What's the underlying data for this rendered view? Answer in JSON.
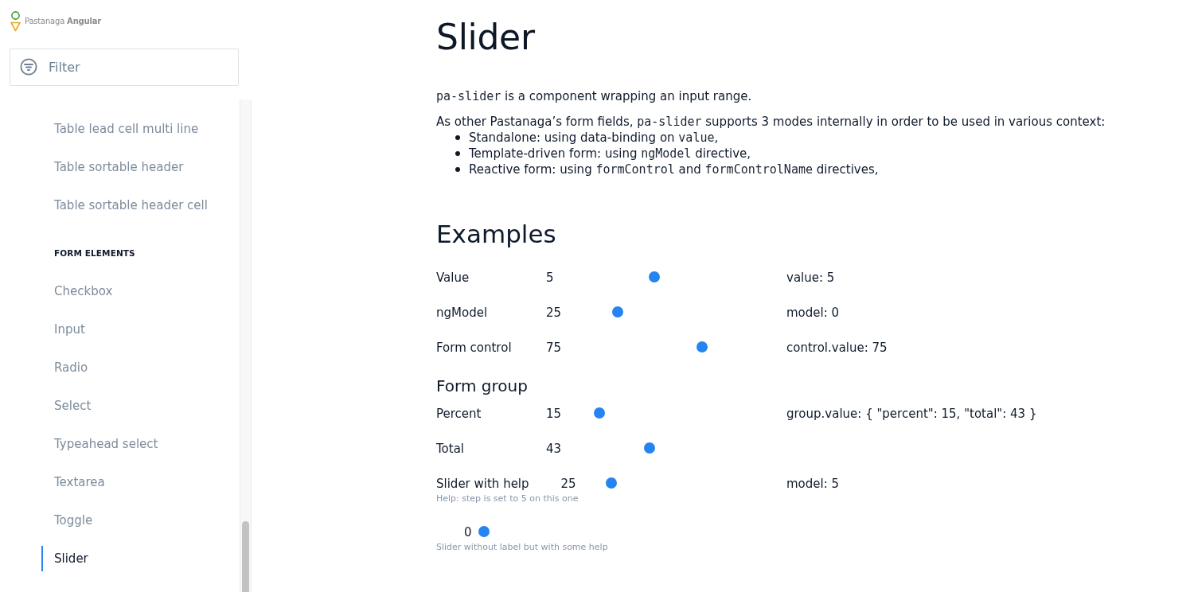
{
  "sidebar": {
    "logo": {
      "text": "Pastanaga **Angular**"
    },
    "filter": {
      "placeholder": "Filter"
    },
    "sections": [
      {
        "items": [
          {
            "label": "Table lead cell multi line",
            "selected": false
          },
          {
            "label": "Table sortable header",
            "selected": false
          },
          {
            "label": "Table sortable header cell",
            "selected": false
          }
        ]
      },
      {
        "heading": "FORM ELEMENTS",
        "items": [
          {
            "label": "Checkbox",
            "selected": false
          },
          {
            "label": "Input",
            "selected": false
          },
          {
            "label": "Radio",
            "selected": false
          },
          {
            "label": "Select",
            "selected": false
          },
          {
            "label": "Typeahead select",
            "selected": false
          },
          {
            "label": "Textarea",
            "selected": false
          },
          {
            "label": "Toggle",
            "selected": false
          },
          {
            "label": "Slider",
            "selected": true
          }
        ]
      }
    ]
  },
  "page": {
    "title": "Slider",
    "intro": [
      [
        {
          "kind": "code",
          "text": "pa-slider"
        },
        {
          "kind": "text",
          "text": " is a component wrapping an input range."
        }
      ],
      [
        {
          "kind": "text",
          "text": "As other Pastanaga’s form fields, "
        },
        {
          "kind": "code",
          "text": "pa-slider"
        },
        {
          "kind": "text",
          "text": " supports 3 modes internally in order to be used in various context:"
        }
      ]
    ],
    "modes": [
      [
        {
          "kind": "text",
          "text": "Standalone: using data-binding on "
        },
        {
          "kind": "code",
          "text": "value"
        },
        {
          "kind": "text",
          "text": ","
        }
      ],
      [
        {
          "kind": "text",
          "text": "Template-driven form: using "
        },
        {
          "kind": "code",
          "text": "ngModel"
        },
        {
          "kind": "text",
          "text": " directive,"
        }
      ],
      [
        {
          "kind": "text",
          "text": "Reactive form: using "
        },
        {
          "kind": "code",
          "text": "formControl"
        },
        {
          "kind": "text",
          "text": " and "
        },
        {
          "kind": "code",
          "text": "formControlName"
        },
        {
          "kind": "text",
          "text": " directives,"
        }
      ]
    ]
  },
  "examples": {
    "heading": "Examples",
    "rows": [
      {
        "kind": "slider",
        "label": "Value",
        "value": "5",
        "level": 0.5,
        "output": "value: 5"
      },
      {
        "kind": "slider",
        "label": "ngModel",
        "value": "25",
        "level": 0.25,
        "output": "model: 0"
      },
      {
        "kind": "slider",
        "label": "Form control",
        "value": "75",
        "level": 0.73,
        "output": "control.value: 75"
      },
      {
        "kind": "heading",
        "label": "Form group"
      },
      {
        "kind": "slider",
        "label": "Percent",
        "value": "15",
        "level": 0.15,
        "output": "group.value: { \"percent\": 15, \"total\": 43 }"
      },
      {
        "kind": "slider",
        "label": "Total",
        "value": "43",
        "level": 0.43
      },
      {
        "kind": "slider",
        "label": "Slider with help",
        "value": "25",
        "level": 0.13,
        "help": "Help: step is set to 5 on this one",
        "output": "model: 5"
      },
      {
        "kind": "slider",
        "value": "0",
        "level": 0,
        "help": "Slider without label but with some help"
      }
    ]
  }
}
